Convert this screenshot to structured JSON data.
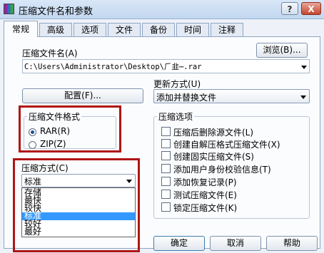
{
  "window": {
    "title": "压缩文件名和参数",
    "buttons": {
      "help": "?",
      "close": "X"
    }
  },
  "tabs": [
    {
      "label": "常规",
      "active": true
    },
    {
      "label": "高级"
    },
    {
      "label": "选项"
    },
    {
      "label": "文件"
    },
    {
      "label": "备份"
    },
    {
      "label": "时间"
    },
    {
      "label": "注释"
    }
  ],
  "archive_name": {
    "label": "压缩文件名(A)",
    "value": "C:\\Users\\Administrator\\Desktop\\⺁⾲⋯.rar",
    "browse_button": "浏览(B)..."
  },
  "update_mode": {
    "label": "更新方式(U)",
    "value": "添加并替换文件"
  },
  "config_button": "配置(F)...",
  "archive_format": {
    "title": "压缩文件格式",
    "options": [
      {
        "label": "RAR(R)",
        "checked": true
      },
      {
        "label": "ZIP(Z)",
        "checked": false
      }
    ]
  },
  "compression": {
    "label": "压缩方式(C)",
    "value": "标准",
    "options": [
      "存储",
      "最快",
      "较快",
      "标准",
      "较好",
      "最好"
    ],
    "selected_index": 3
  },
  "archive_options": {
    "title": "压缩选项",
    "items": [
      "压缩后删除源文件(L)",
      "创建自解压格式压缩文件(X)",
      "创建固实压缩文件(S)",
      "添加用户身份校验信息(T)",
      "添加恢复记录(P)",
      "测试压缩文件(E)",
      "锁定压缩文件(K)"
    ]
  },
  "footer": {
    "ok": "确定",
    "cancel": "取消",
    "help": "帮助"
  },
  "colors": {
    "highlight_box": "#b01515",
    "selection": "#3399ff"
  }
}
